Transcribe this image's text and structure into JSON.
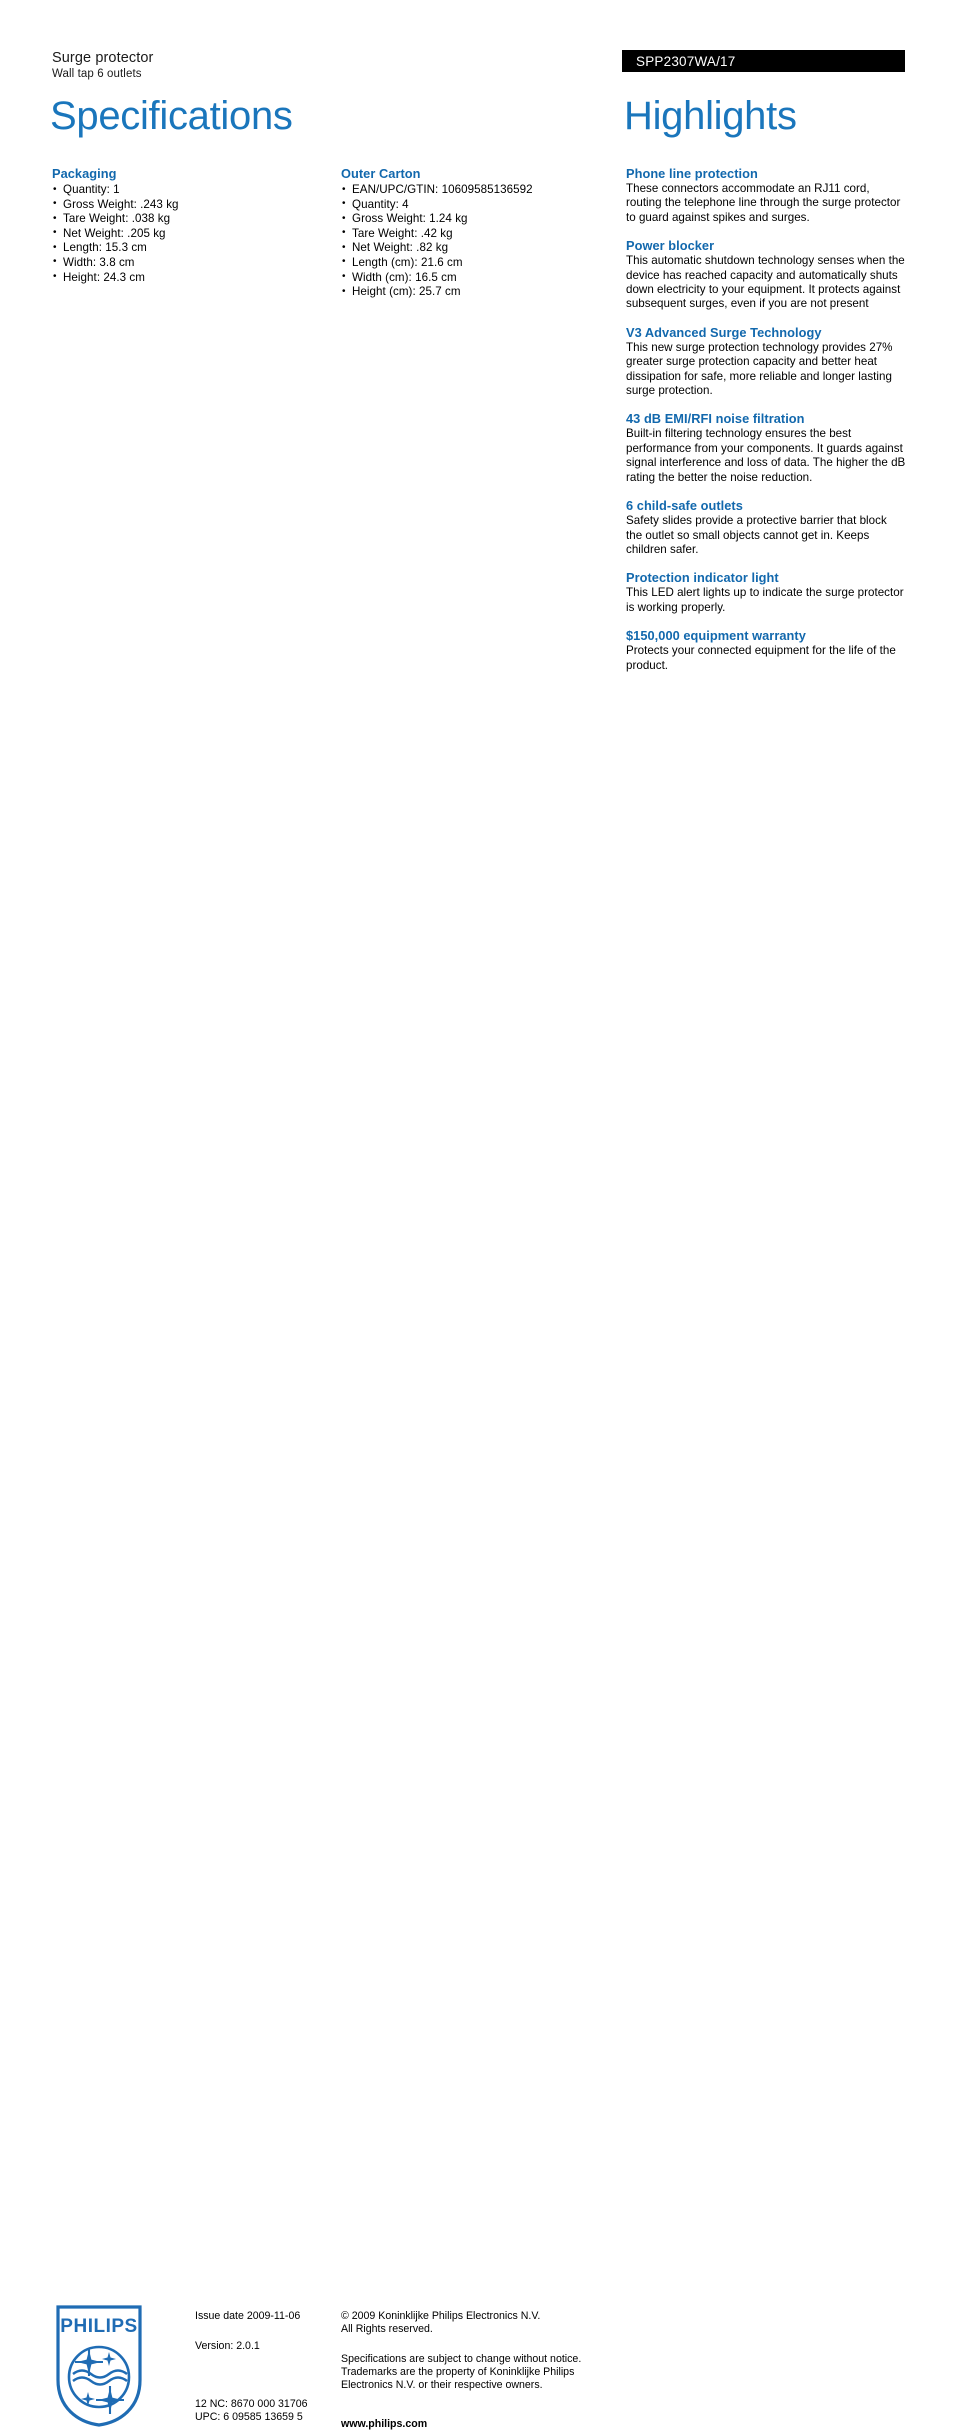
{
  "header": {
    "product_name": "Surge protector",
    "product_subtitle": "Wall tap 6 outlets",
    "model_number": "SPP2307WA/17",
    "title_specifications": "Specifications",
    "title_highlights": "Highlights"
  },
  "specifications": {
    "packaging": {
      "title": "Packaging",
      "items": [
        "Quantity: 1",
        "Gross Weight: .243 kg",
        "Tare Weight: .038 kg",
        "Net Weight: .205 kg",
        "Length: 15.3 cm",
        "Width: 3.8 cm",
        "Height: 24.3 cm"
      ]
    },
    "outer_carton": {
      "title": "Outer Carton",
      "items": [
        "EAN/UPC/GTIN: 10609585136592",
        "Quantity: 4",
        "Gross Weight: 1.24 kg",
        "Tare Weight: .42 kg",
        "Net Weight: .82 kg",
        "Length (cm): 21.6 cm",
        "Width (cm): 16.5 cm",
        "Height (cm): 25.7 cm"
      ]
    }
  },
  "highlights": [
    {
      "title": "Phone line protection",
      "body": "These connectors accommodate an RJ11 cord, routing the telephone line through the surge protector to guard against spikes and surges."
    },
    {
      "title": "Power blocker",
      "body": "This automatic shutdown technology senses when the device has reached capacity and automatically shuts down electricity to your equipment. It protects against subsequent surges, even if you are not present"
    },
    {
      "title": "V3 Advanced Surge Technology",
      "body": "This new surge protection technology provides 27% greater surge protection capacity and better heat dissipation for safe, more reliable and longer lasting surge protection."
    },
    {
      "title": "43 dB EMI/RFI noise filtration",
      "body": "Built-in filtering technology ensures the best performance from your components. It guards against signal interference and loss of data. The higher the dB rating the better the noise reduction."
    },
    {
      "title": "6 child-safe outlets",
      "body": "Safety slides provide a protective barrier that block the outlet so small objects cannot get in. Keeps children safer."
    },
    {
      "title": "Protection indicator light",
      "body": "This LED alert lights up to indicate the surge protector is working properly."
    },
    {
      "title": "$150,000 equipment warranty",
      "body": "Protects your connected equipment for the life of the product."
    }
  ],
  "footer": {
    "logo_wordmark": "PHILIPS",
    "issue_date": "Issue date 2009-11-06",
    "version": "Version: 2.0.1",
    "twelve_nc": "12 NC: 8670 000 31706",
    "upc": "UPC: 6 09585 13659 5",
    "copyright_line1": "© 2009 Koninklijke Philips Electronics N.V.",
    "copyright_line2": "All Rights reserved.",
    "notice_line1": "Specifications are subject to change without notice.",
    "notice_line2": "Trademarks are the property of Koninklijke Philips",
    "notice_line3": "Electronics N.V. or their respective owners.",
    "website": "www.philips.com"
  },
  "colors": {
    "title_blue": "#1a76bc",
    "heading_blue": "#1268ad",
    "banner_black": "#000000",
    "logo_blue": "#1f6cb4"
  }
}
